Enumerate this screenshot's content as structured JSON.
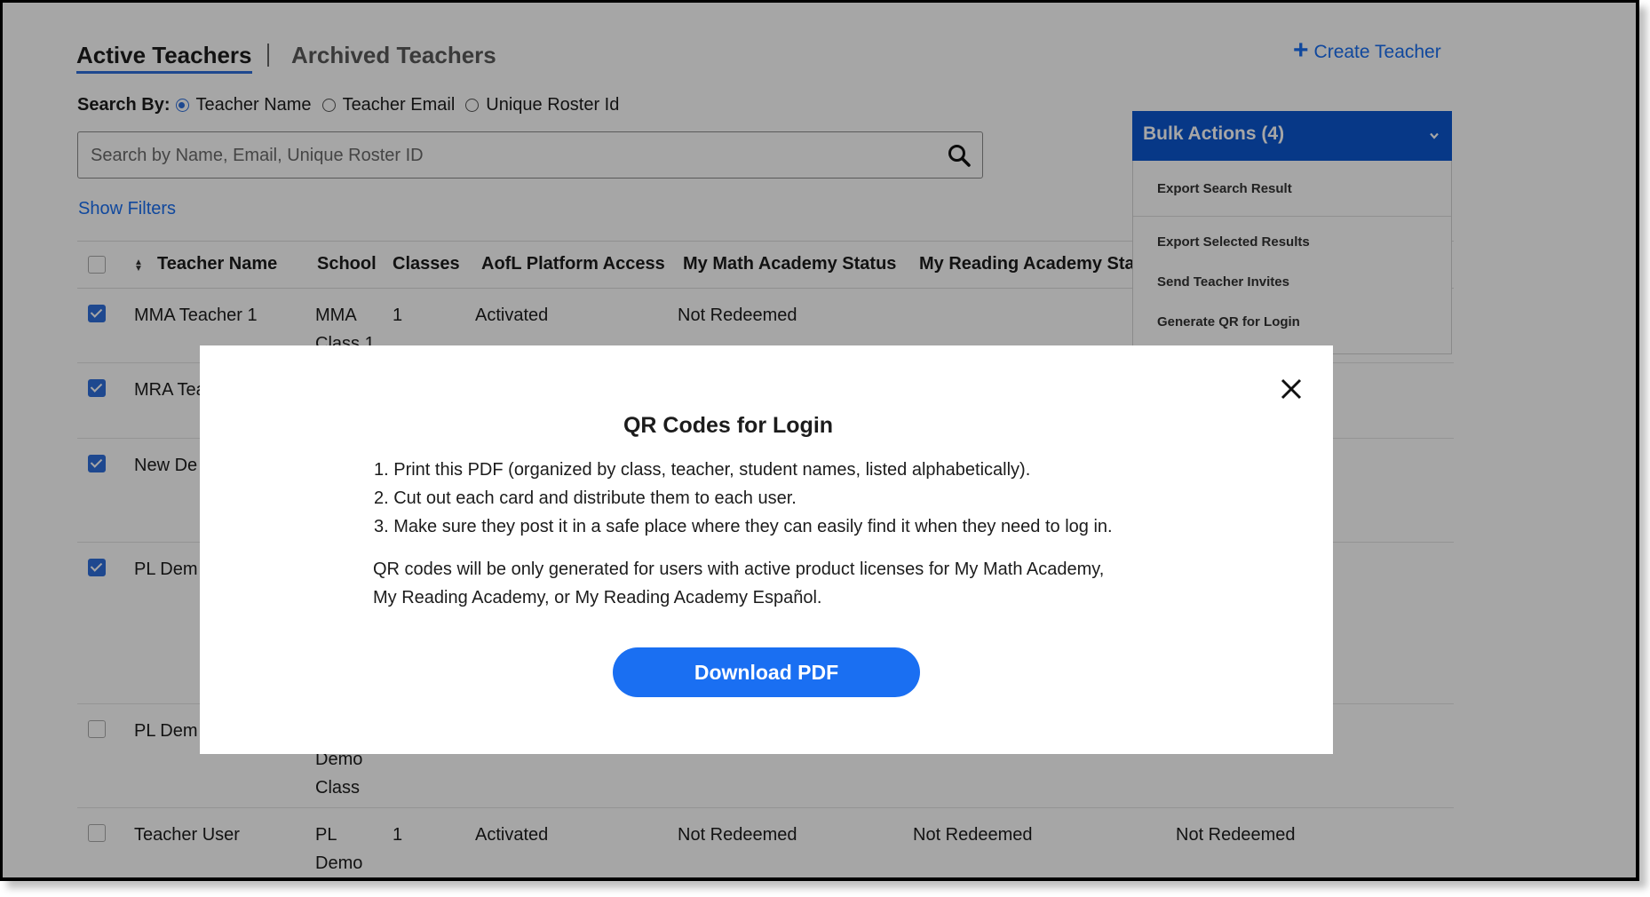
{
  "tabs": {
    "active": "Active Teachers",
    "archived": "Archived Teachers"
  },
  "create_teacher": {
    "label": "Create Teacher",
    "icon": "plus-icon"
  },
  "search": {
    "by_label": "Search By:",
    "options": [
      "Teacher Name",
      "Teacher Email",
      "Unique Roster Id"
    ],
    "selected": "Teacher Name",
    "placeholder": "Search by Name, Email, Unique Roster ID",
    "value": ""
  },
  "show_filters": "Show Filters",
  "table": {
    "headers": [
      "Teacher Name",
      "School",
      "Classes",
      "AofL Platform Access",
      "My Math Academy Status",
      "My Reading Academy Sta"
    ],
    "rows": [
      {
        "checked": true,
        "name": "MMA Teacher 1",
        "school": "MMA Class 1",
        "classes": "1",
        "access": "Activated",
        "mma": "Not Redeemed",
        "mra": "",
        "extra": ""
      },
      {
        "checked": true,
        "name": "MRA Tea",
        "school": "",
        "classes": "",
        "access": "",
        "mma": "",
        "mra": "",
        "extra": ""
      },
      {
        "checked": true,
        "name": "New De",
        "school": "",
        "classes": "",
        "access": "",
        "mma": "",
        "mra": "",
        "extra": ""
      },
      {
        "checked": true,
        "name": "PL Dem",
        "school": "",
        "classes": "",
        "access": "",
        "mma": "",
        "mra": "",
        "extra": ""
      },
      {
        "checked": false,
        "name": "PL Dem",
        "school": "Demo Class",
        "classes": "",
        "access": "",
        "mma": "",
        "mra": "",
        "extra": ""
      },
      {
        "checked": false,
        "name": "Teacher User",
        "school": "PL Demo",
        "classes": "1",
        "access": "Activated",
        "mma": "Not Redeemed",
        "mra": "Not Redeemed",
        "extra": "Not Redeemed"
      }
    ]
  },
  "bulk_actions": {
    "label": "Bulk Actions (4)",
    "items": [
      "Export Search Result",
      "Export Selected Results",
      "Send Teacher Invites",
      "Generate QR for Login"
    ]
  },
  "modal": {
    "title": "QR Codes for Login",
    "steps": [
      "1. Print this PDF (organized by class, teacher, student names, listed alphabetically).",
      "2. Cut out each card and distribute them to each user.",
      "3. Make sure they post it in a safe place where they can easily find it when they need to log in."
    ],
    "note_line1": "QR codes will be only generated for users with active product licenses for My Math Academy,",
    "note_line2": "My Reading Academy, or My Reading Academy Español.",
    "download_label": "Download PDF"
  },
  "colors": {
    "accent": "#1a6ff2",
    "bulk_bg": "#0b57d0",
    "checkbox": "#2f6fdc"
  }
}
